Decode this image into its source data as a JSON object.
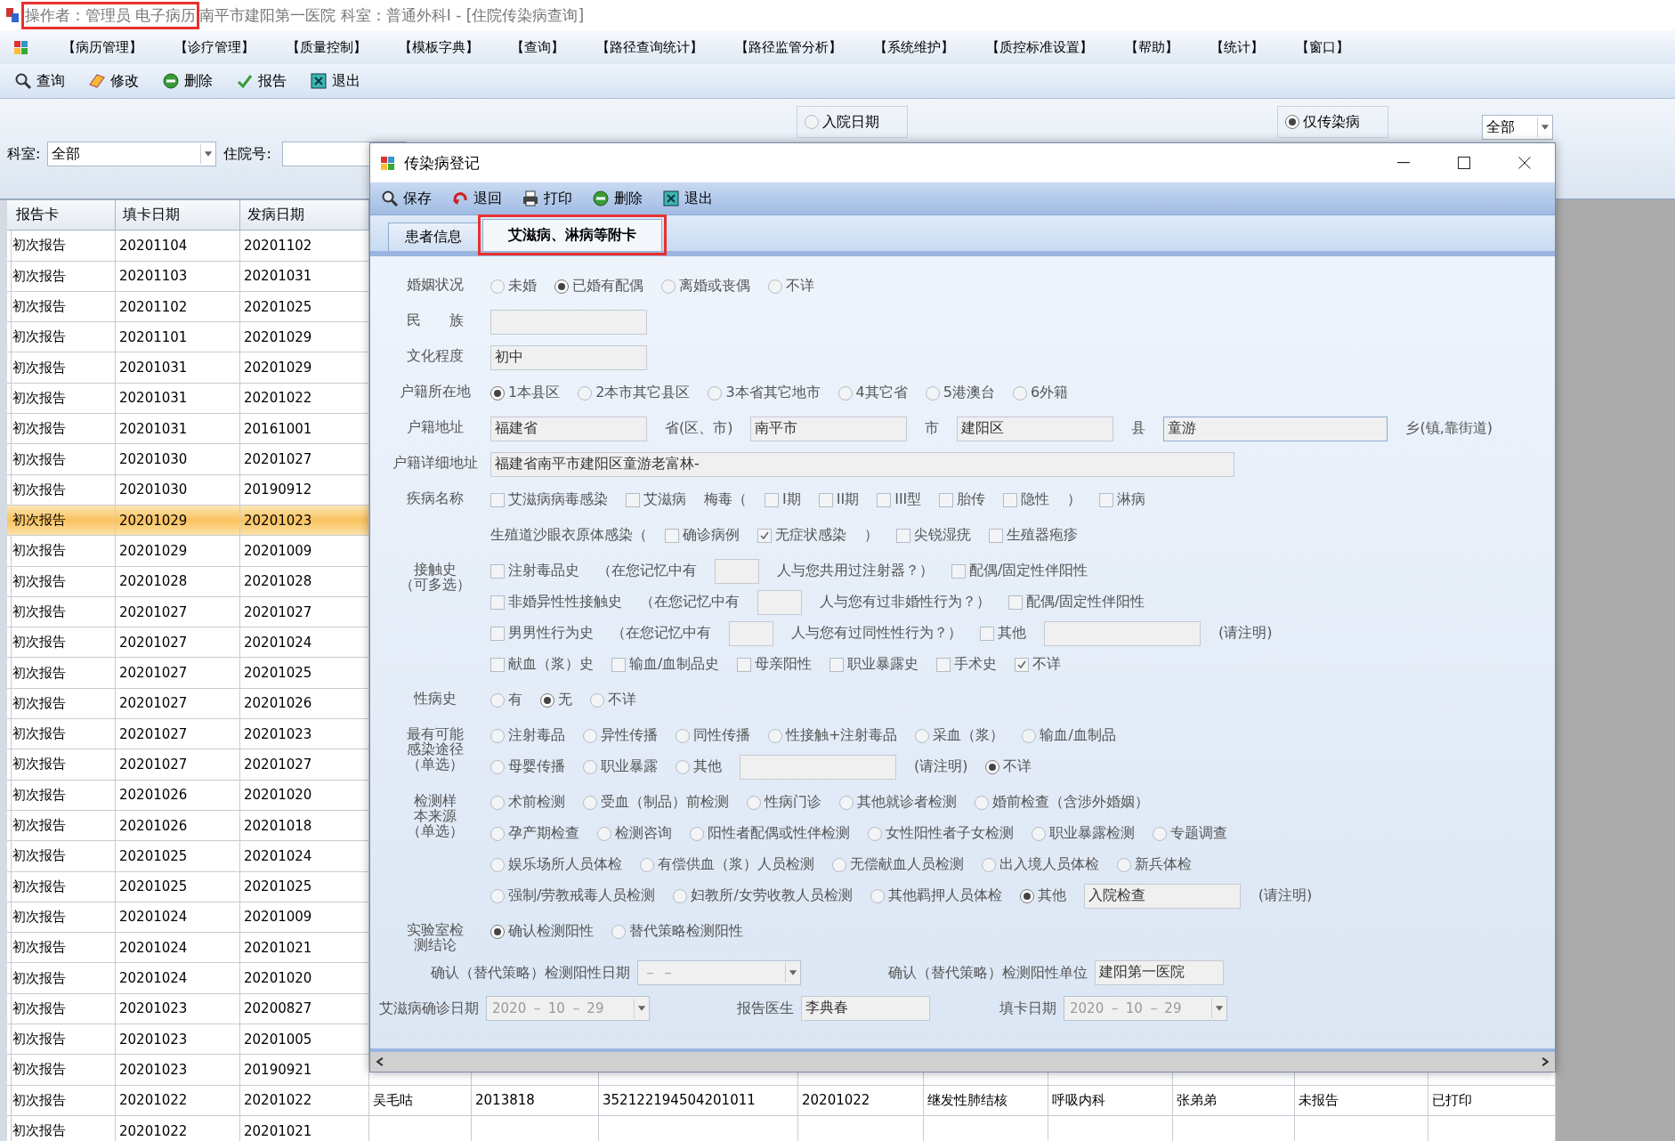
{
  "title_bar": {
    "operator": {
      "text": "操作者：管理员 电子病历",
      "highlighted": true
    },
    "text": "南平市建阳第一医院  科室：普通外科Ⅰ - [住院传染病查询]"
  },
  "menu": [
    "【病历管理】",
    "【诊疗管理】",
    "【质量控制】",
    "【模板字典】",
    "【查询】",
    "【路径查询统计】",
    "【路径监管分析】",
    "【系统维护】",
    "【质控标准设置】",
    "【帮助】",
    "【统计】",
    "【窗口】"
  ],
  "toolbar": [
    {
      "kind": "query",
      "label": "查询"
    },
    {
      "kind": "edit",
      "label": "修改"
    },
    {
      "kind": "delete",
      "label": "删除"
    },
    {
      "kind": "report",
      "label": "报告"
    },
    {
      "kind": "exit",
      "label": "退出"
    }
  ],
  "filter": {
    "dept_label": "科室:",
    "dept_value": "全部",
    "inpatient_label": "住院号:",
    "date_radio": {
      "label": "入院日期",
      "selected": false
    },
    "infect_radio": {
      "label": "仅传染病",
      "selected": true
    },
    "right_combo": "全部"
  },
  "table": {
    "columns": [
      "报告卡",
      "填卡日期",
      "发病日期"
    ],
    "rows": [
      {
        "cells": [
          "初次报告",
          "20201104",
          "20201102"
        ],
        "selected": false
      },
      {
        "cells": [
          "初次报告",
          "20201103",
          "20201031"
        ],
        "selected": false
      },
      {
        "cells": [
          "初次报告",
          "20201102",
          "20201025"
        ],
        "selected": false
      },
      {
        "cells": [
          "初次报告",
          "20201101",
          "20201029"
        ],
        "selected": false
      },
      {
        "cells": [
          "初次报告",
          "20201031",
          "20201029"
        ],
        "selected": false
      },
      {
        "cells": [
          "初次报告",
          "20201031",
          "20201022"
        ],
        "selected": false
      },
      {
        "cells": [
          "初次报告",
          "20201031",
          "20161001"
        ],
        "selected": false
      },
      {
        "cells": [
          "初次报告",
          "20201030",
          "20201027"
        ],
        "selected": false
      },
      {
        "cells": [
          "初次报告",
          "20201030",
          "20190912"
        ],
        "selected": false
      },
      {
        "cells": [
          "初次报告",
          "20201029",
          "20201023"
        ],
        "selected": true
      },
      {
        "cells": [
          "初次报告",
          "20201029",
          "20201009"
        ],
        "selected": false
      },
      {
        "cells": [
          "初次报告",
          "20201028",
          "20201028"
        ],
        "selected": false
      },
      {
        "cells": [
          "初次报告",
          "20201027",
          "20201027"
        ],
        "selected": false
      },
      {
        "cells": [
          "初次报告",
          "20201027",
          "20201024"
        ],
        "selected": false
      },
      {
        "cells": [
          "初次报告",
          "20201027",
          "20201025"
        ],
        "selected": false
      },
      {
        "cells": [
          "初次报告",
          "20201027",
          "20201026"
        ],
        "selected": false
      },
      {
        "cells": [
          "初次报告",
          "20201027",
          "20201023"
        ],
        "selected": false
      },
      {
        "cells": [
          "初次报告",
          "20201027",
          "20201027"
        ],
        "selected": false
      },
      {
        "cells": [
          "初次报告",
          "20201026",
          "20201020"
        ],
        "selected": false
      },
      {
        "cells": [
          "初次报告",
          "20201026",
          "20201018"
        ],
        "selected": false
      },
      {
        "cells": [
          "初次报告",
          "20201025",
          "20201024"
        ],
        "selected": false
      },
      {
        "cells": [
          "初次报告",
          "20201025",
          "20201025"
        ],
        "selected": false
      },
      {
        "cells": [
          "初次报告",
          "20201024",
          "20201009"
        ],
        "selected": false
      },
      {
        "cells": [
          "初次报告",
          "20201024",
          "20201021"
        ],
        "selected": false
      },
      {
        "cells": [
          "初次报告",
          "20201024",
          "20201020"
        ],
        "selected": false
      },
      {
        "cells": [
          "初次报告",
          "20201023",
          "20200827"
        ],
        "selected": false
      },
      {
        "cells": [
          "初次报告",
          "20201023",
          "20201005"
        ],
        "selected": false
      },
      {
        "cells": [
          "初次报告",
          "20201023",
          "20190921"
        ],
        "selected": false
      },
      {
        "cells": [
          "初次报告",
          "20201022",
          "20201022",
          "吴毛咕",
          "2013818",
          "352122194504201011",
          "20201022",
          "继发性肺结核",
          "呼吸内科",
          "张弟弟",
          "未报告",
          "已打印"
        ],
        "selected": false
      },
      {
        "cells": [
          "初次报告",
          "20201022",
          "20201021"
        ],
        "selected": false
      }
    ]
  },
  "dialog": {
    "title": "传染病登记",
    "toolbar": [
      {
        "kind": "save",
        "label": "保存"
      },
      {
        "kind": "return",
        "label": "退回"
      },
      {
        "kind": "print",
        "label": "打印"
      },
      {
        "kind": "delete",
        "label": "删除"
      },
      {
        "kind": "exit",
        "label": "退出"
      }
    ],
    "tabs": [
      {
        "label": "患者信息",
        "selected": false,
        "highlighted": false
      },
      {
        "label": "艾滋病、淋病等附卡",
        "selected": true,
        "highlighted": true
      }
    ],
    "form": [
      {
        "label": "婚姻状况",
        "rows": [
          [
            {
              "kind": "radio",
              "label": "未婚",
              "selected": false
            },
            {
              "kind": "radio",
              "label": "已婚有配偶",
              "selected": true
            },
            {
              "kind": "radio",
              "label": "离婚或丧偶",
              "selected": false
            },
            {
              "kind": "radio",
              "label": "不详",
              "selected": false
            }
          ]
        ]
      },
      {
        "label": "民　　族",
        "rows": [
          [
            {
              "kind": "field"
            }
          ]
        ]
      },
      {
        "label": "文化程度",
        "rows": [
          [
            {
              "kind": "field",
              "value": "初中"
            }
          ]
        ]
      },
      {
        "label": "户籍所在地",
        "rows": [
          [
            {
              "kind": "radio",
              "label": "1本县区",
              "selected": true
            },
            {
              "kind": "radio",
              "label": "2本市其它县区",
              "selected": false
            },
            {
              "kind": "radio",
              "label": "3本省其它地市",
              "selected": false
            },
            {
              "kind": "radio",
              "label": "4其它省",
              "selected": false
            },
            {
              "kind": "radio",
              "label": "5港澳台",
              "selected": false
            },
            {
              "kind": "radio",
              "label": "6外籍",
              "selected": false
            }
          ]
        ]
      },
      {
        "label": "户籍地址",
        "rows": [
          [
            {
              "kind": "field",
              "value": "福建省"
            },
            {
              "kind": "text",
              "text": "省(区、市)"
            },
            {
              "kind": "field",
              "value": "南平市"
            },
            {
              "kind": "text",
              "text": "市"
            },
            {
              "kind": "field",
              "value": "建阳区"
            },
            {
              "kind": "text",
              "text": "县"
            },
            {
              "kind": "widefield",
              "value": "童游"
            },
            {
              "kind": "text",
              "text": "乡(镇,靠街道)"
            }
          ]
        ]
      },
      {
        "label": "户籍详细地址",
        "rows": [
          [
            {
              "kind": "longfield",
              "value": "福建省南平市建阳区童游老富林-"
            }
          ]
        ]
      },
      {
        "label": "疾病名称",
        "rows": [
          [
            {
              "kind": "checkbox",
              "label": "艾滋病病毒感染",
              "checked": false
            },
            {
              "kind": "checkbox",
              "label": "艾滋病",
              "checked": false
            },
            {
              "kind": "text",
              "text": "梅毒（"
            },
            {
              "kind": "checkbox",
              "label": "I期",
              "checked": false
            },
            {
              "kind": "checkbox",
              "label": "II期",
              "checked": false
            },
            {
              "kind": "checkbox",
              "label": "III型",
              "checked": false
            },
            {
              "kind": "checkbox",
              "label": "胎传",
              "checked": false
            },
            {
              "kind": "checkbox",
              "label": "隐性",
              "checked": false
            },
            {
              "kind": "text",
              "text": "）"
            },
            {
              "kind": "checkbox",
              "label": "淋病",
              "checked": false
            }
          ]
        ]
      },
      {
        "kind": "continuation",
        "rows": [
          [
            {
              "kind": "text",
              "text": "生殖道沙眼衣原体感染（"
            },
            {
              "kind": "checkbox",
              "label": "确诊病例",
              "checked": false
            },
            {
              "kind": "checkbox",
              "label": "无症状感染",
              "checked": true
            },
            {
              "kind": "text",
              "text": "）"
            },
            {
              "kind": "checkbox",
              "label": "尖锐湿疣",
              "checked": false
            },
            {
              "kind": "checkbox",
              "label": "生殖器疱疹",
              "checked": false
            }
          ]
        ]
      },
      {
        "label": [
          "接触史",
          "（可多选）"
        ],
        "rows": [
          [
            {
              "kind": "checkbox",
              "label": "注射毒品史",
              "checked": false
            },
            {
              "kind": "text",
              "text": "（在您记忆中有"
            },
            {
              "kind": "smallfield"
            },
            {
              "kind": "text",
              "text": "人与您共用过注射器？）"
            },
            {
              "kind": "checkbox",
              "label": "配偶/固定性伴阳性",
              "checked": false
            }
          ],
          [
            {
              "kind": "checkbox",
              "label": "非婚异性性接触史",
              "checked": false
            },
            {
              "kind": "text",
              "text": "（在您记忆中有"
            },
            {
              "kind": "smallfield"
            },
            {
              "kind": "text",
              "text": "人与您有过非婚性行为？）"
            },
            {
              "kind": "checkbox",
              "label": "配偶/固定性伴阳性",
              "checked": false
            }
          ],
          [
            {
              "kind": "checkbox",
              "label": "男男性行为史",
              "checked": false
            },
            {
              "kind": "text",
              "text": "（在您记忆中有"
            },
            {
              "kind": "smallfield"
            },
            {
              "kind": "text",
              "text": "人与您有过同性性行为？）"
            },
            {
              "kind": "checkbox",
              "label": "其他",
              "checked": false
            },
            {
              "kind": "field"
            },
            {
              "kind": "text",
              "text": "(请注明)"
            }
          ],
          [
            {
              "kind": "checkbox",
              "label": "献血（浆）史",
              "checked": false
            },
            {
              "kind": "checkbox",
              "label": "输血/血制品史",
              "checked": false
            },
            {
              "kind": "checkbox",
              "label": "母亲阳性",
              "checked": false
            },
            {
              "kind": "checkbox",
              "label": "职业暴露史",
              "checked": false
            },
            {
              "kind": "checkbox",
              "label": "手术史",
              "checked": false
            },
            {
              "kind": "checkbox",
              "label": "不详",
              "checked": true
            }
          ]
        ]
      },
      {
        "label": "性病史",
        "rows": [
          [
            {
              "kind": "radio",
              "label": "有",
              "selected": false
            },
            {
              "kind": "radio",
              "label": "无",
              "selected": true
            },
            {
              "kind": "radio",
              "label": "不详",
              "selected": false
            }
          ]
        ]
      },
      {
        "label": [
          "最有可能",
          "感染途径",
          "（单选）"
        ],
        "rows": [
          [
            {
              "kind": "radio",
              "label": "注射毒品",
              "selected": false
            },
            {
              "kind": "radio",
              "label": "异性传播",
              "selected": false
            },
            {
              "kind": "radio",
              "label": "同性传播",
              "selected": false
            },
            {
              "kind": "radio",
              "label": "性接触+注射毒品",
              "selected": false
            },
            {
              "kind": "radio",
              "label": "采血（浆）",
              "selected": false
            },
            {
              "kind": "radio",
              "label": "输血/血制品",
              "selected": false
            }
          ],
          [
            {
              "kind": "radio",
              "label": "母婴传播",
              "selected": false
            },
            {
              "kind": "radio",
              "label": "职业暴露",
              "selected": false
            },
            {
              "kind": "radio",
              "label": "其他",
              "selected": false
            },
            {
              "kind": "field"
            },
            {
              "kind": "text",
              "text": "(请注明)"
            },
            {
              "kind": "radio",
              "label": "不详",
              "selected": true
            }
          ]
        ]
      },
      {
        "label": [
          "检测样",
          "本来源",
          "（单选）"
        ],
        "rows": [
          [
            {
              "kind": "radio",
              "label": "术前检测",
              "selected": false
            },
            {
              "kind": "radio",
              "label": "受血（制品）前检测",
              "selected": false
            },
            {
              "kind": "radio",
              "label": "性病门诊",
              "selected": false
            },
            {
              "kind": "radio",
              "label": "其他就诊者检测",
              "selected": false
            },
            {
              "kind": "radio",
              "label": "婚前检查（含涉外婚姻）",
              "selected": false
            }
          ],
          [
            {
              "kind": "radio",
              "label": "孕产期检查",
              "selected": false
            },
            {
              "kind": "radio",
              "label": "检测咨询",
              "selected": false
            },
            {
              "kind": "radio",
              "label": "阳性者配偶或性伴检测",
              "selected": false
            },
            {
              "kind": "radio",
              "label": "女性阳性者子女检测",
              "selected": false
            },
            {
              "kind": "radio",
              "label": "职业暴露检测",
              "selected": false
            },
            {
              "kind": "radio",
              "label": "专题调查",
              "selected": false
            }
          ],
          [
            {
              "kind": "radio",
              "label": "娱乐场所人员体检",
              "selected": false
            },
            {
              "kind": "radio",
              "label": "有偿供血（浆）人员检测",
              "selected": false
            },
            {
              "kind": "radio",
              "label": "无偿献血人员检测",
              "selected": false
            },
            {
              "kind": "radio",
              "label": "出入境人员体检",
              "selected": false
            },
            {
              "kind": "radio",
              "label": "新兵体检",
              "selected": false
            }
          ],
          [
            {
              "kind": "radio",
              "label": "强制/劳教戒毒人员检测",
              "selected": false
            },
            {
              "kind": "radio",
              "label": "妇教所/女劳收教人员检测",
              "selected": false
            },
            {
              "kind": "radio",
              "label": "其他羁押人员体检",
              "selected": false
            },
            {
              "kind": "radio",
              "label": "其他",
              "selected": true
            },
            {
              "kind": "field",
              "value": "入院检查"
            },
            {
              "kind": "text",
              "text": "(请注明)"
            }
          ]
        ]
      },
      {
        "label": [
          "实验室检",
          "测结论"
        ],
        "rows": [
          [
            {
              "kind": "radio",
              "label": "确认检测阳性",
              "selected": true
            },
            {
              "kind": "radio",
              "label": "替代策略检测阳性",
              "selected": false
            }
          ]
        ]
      },
      {
        "rows": [
          [
            {
              "kind": "text",
              "text": "确认（替代策略）检测阳性日期"
            },
            {
              "kind": "combo",
              "value": "－  －"
            },
            {
              "kind": "text",
              "text": "确认（替代策略）检测阳性单位"
            },
            {
              "kind": "field",
              "value": "建阳第一医院"
            }
          ]
        ]
      },
      {
        "rows": [
          [
            {
              "kind": "text",
              "text": "艾滋病确诊日期"
            },
            {
              "kind": "combo",
              "value": "2020 － 10 － 29"
            },
            {
              "kind": "text",
              "text": "报告医生"
            },
            {
              "kind": "field",
              "value": "李典春"
            },
            {
              "kind": "text",
              "text": "填卡日期"
            },
            {
              "kind": "combo",
              "value": "2020 － 10 － 29"
            }
          ]
        ]
      }
    ]
  }
}
